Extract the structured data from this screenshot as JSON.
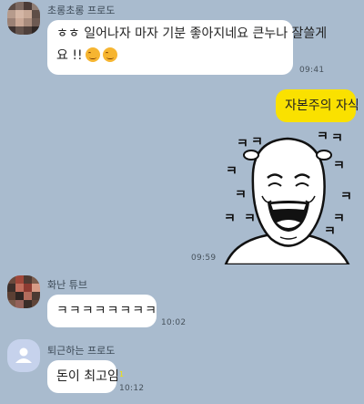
{
  "messages": [
    {
      "sender": "초롱초롱 프로도",
      "line1": "ㅎㅎ 일어나자 마자 기분 좋아지네요 큰누나 잘쓸게",
      "line2": "요 !!",
      "time": "09:41",
      "emojis": [
        "wink-face-emoji",
        "wink-face-emoji"
      ]
    },
    {
      "sender": "me",
      "text": "자본주의 자식",
      "time": "09:59",
      "sticker": {
        "name": "laughing-face-sticker",
        "chars": [
          "ㅋ",
          "ㅋ",
          "ㅋ",
          "ㅋ",
          "ㅋ",
          "ㅋ",
          "ㅋ",
          "ㅋ",
          "ㅋ",
          "ㅋ",
          "ㅋ",
          "ㅋ"
        ]
      }
    },
    {
      "sender": "화난 튜브",
      "text": "ㅋㅋㅋㅋㅋㅋㅋㅋ",
      "time": "10:02"
    },
    {
      "sender": "퇴근하는 프로도",
      "text": "돈이 최고임",
      "time": "10:12",
      "unread": "1"
    }
  ],
  "colors": {
    "background": "#a9bbce",
    "my_bubble": "#fae100",
    "other_bubble": "#ffffff"
  }
}
